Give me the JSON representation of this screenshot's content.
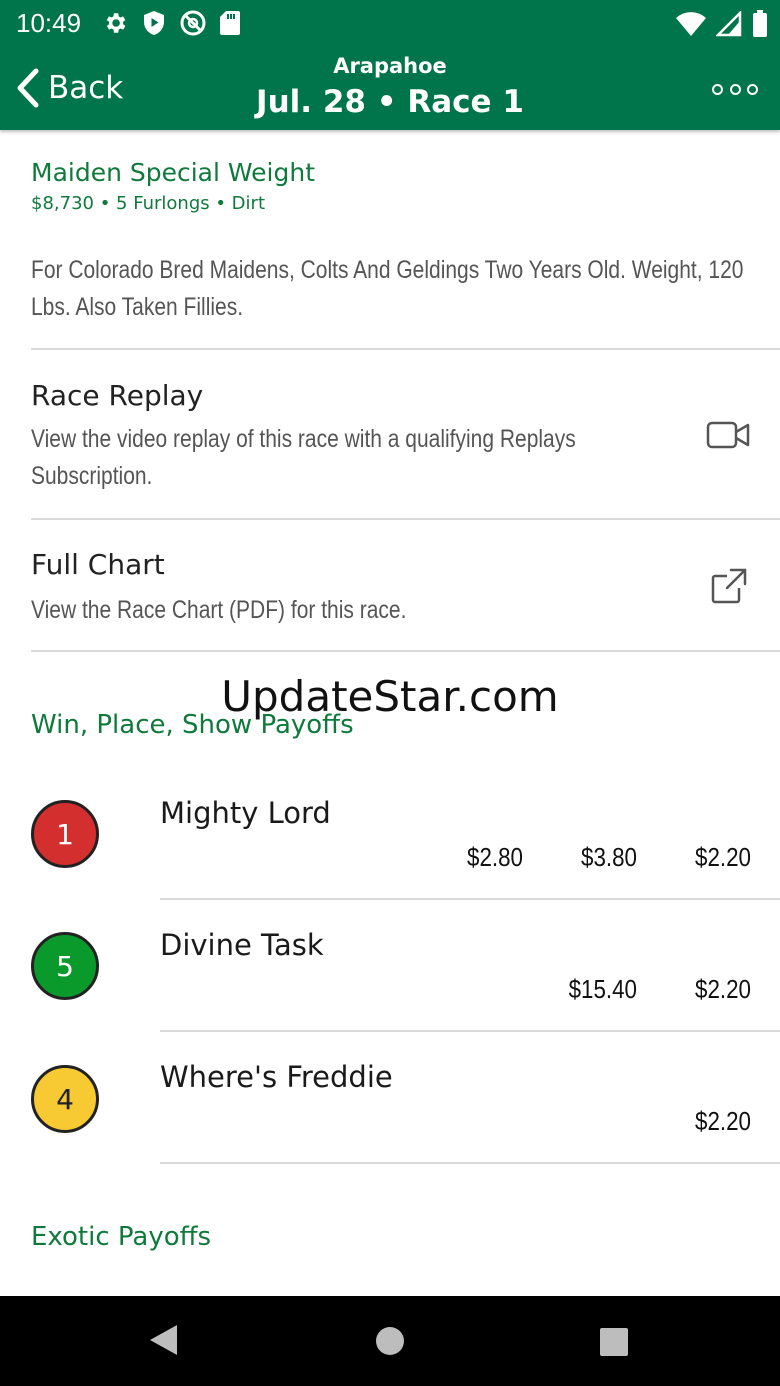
{
  "status_bar": {
    "time": "10:49",
    "icons": [
      "gear-icon",
      "shield-play-icon",
      "blocked-at-icon",
      "sd-card-icon"
    ],
    "right_icons": [
      "wifi-icon",
      "cell-signal-icon",
      "battery-icon"
    ]
  },
  "app_bar": {
    "back_label": "Back",
    "track": "Arapahoe",
    "race": "Jul. 28 • Race 1"
  },
  "race_info": {
    "type": "Maiden Special Weight",
    "details": "$8,730 • 5 Furlongs • Dirt",
    "conditions": "For Colorado Bred Maidens, Colts And Geldings Two Years Old. Weight, 120 Lbs. Also Taken Fillies."
  },
  "replay": {
    "title": "Race Replay",
    "desc": "View the video replay of this race with a qualifying Replays Subscription."
  },
  "chart": {
    "title": "Full Chart",
    "desc": "View the Race Chart (PDF) for this race."
  },
  "watermark": "UpdateStar.com",
  "payoffs": {
    "heading": "Win, Place, Show Payoffs",
    "rows": [
      {
        "number": "1",
        "color": "#d32f2f",
        "horse": "Mighty Lord",
        "win": "$2.80",
        "place": "$3.80",
        "show": "$2.20"
      },
      {
        "number": "5",
        "color": "#0a9a2c",
        "horse": "Divine Task",
        "win": "",
        "place": "$15.40",
        "show": "$2.20"
      },
      {
        "number": "4",
        "color": "#f7c933",
        "horse": "Where's Freddie",
        "win": "",
        "place": "",
        "show": "$2.20"
      }
    ]
  },
  "exotic": {
    "heading": "Exotic Payoffs"
  },
  "colors": {
    "brand": "#00744a",
    "accent_text": "#0f7a3c"
  }
}
